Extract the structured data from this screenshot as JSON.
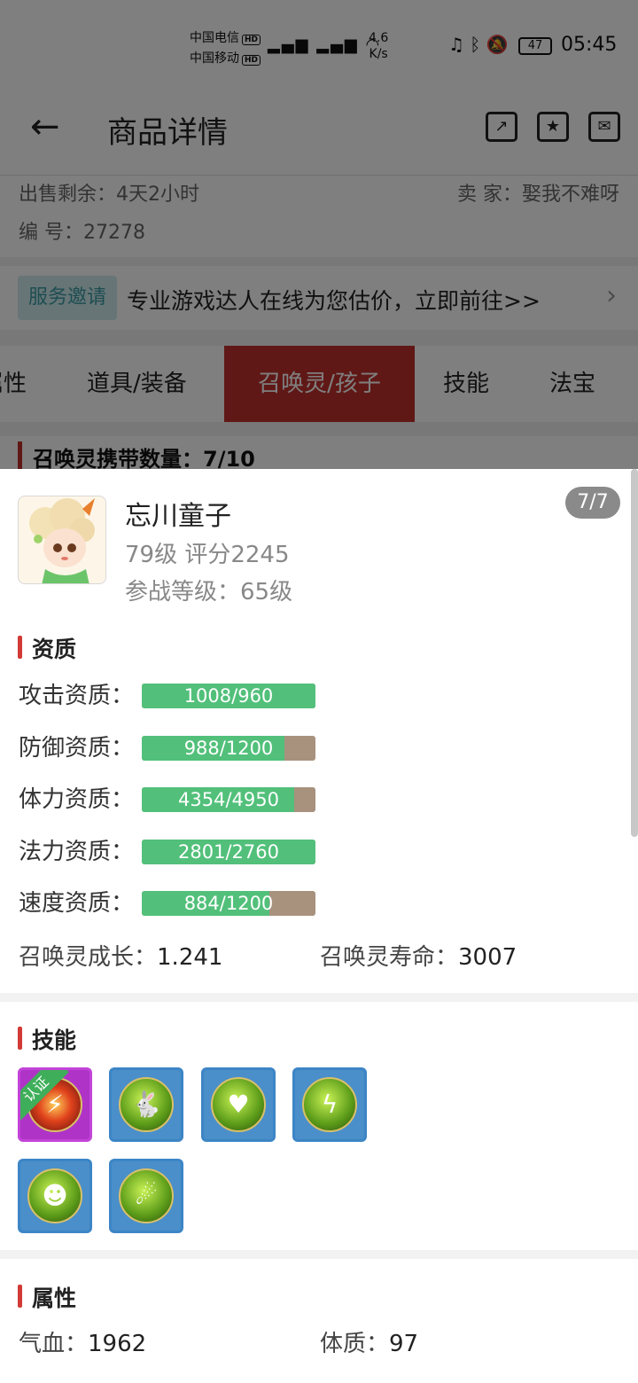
{
  "status_bar": {
    "carrier1": "中国电信",
    "carrier2": "中国移动",
    "hd": "HD",
    "net_speed_value": "4.6",
    "net_speed_unit": "K/s",
    "battery": "47",
    "time": "05:45"
  },
  "nav": {
    "back_icon": "arrow-left-icon",
    "title": "商品详情",
    "icons": [
      "share-icon",
      "favorite-folder-icon",
      "message-icon"
    ]
  },
  "listing": {
    "remaining": "出售剩余：4天2小时",
    "seller": "卖  家：娶我不难呀",
    "number": "编  号：27278"
  },
  "service": {
    "badge": "服务邀请",
    "text": "专业游戏达人在线为您估价，立即前往>>",
    "arrow": "›"
  },
  "tabs": [
    {
      "label": "属性",
      "active": false
    },
    {
      "label": "道具/装备",
      "active": false
    },
    {
      "label": "召唤灵/孩子",
      "active": true
    },
    {
      "label": "技能",
      "active": false
    },
    {
      "label": "法宝",
      "active": false
    }
  ],
  "summon_count": "召唤灵携带数量：7/10",
  "pet": {
    "name": "忘川童子",
    "level_score": "79级 评分2245",
    "battle_level": "参战等级：65级",
    "index": "7/7"
  },
  "aptitude": {
    "title": "资质",
    "rows": [
      {
        "label": "攻击资质：",
        "text": "1008/960",
        "ratio": 1.0
      },
      {
        "label": "防御资质：",
        "text": "988/1200",
        "ratio": 0.823
      },
      {
        "label": "体力资质：",
        "text": "4354/4950",
        "ratio": 0.88
      },
      {
        "label": "法力资质：",
        "text": "2801/2760",
        "ratio": 1.0
      },
      {
        "label": "速度资质：",
        "text": "884/1200",
        "ratio": 0.737
      }
    ],
    "growth_label": "召唤灵成长：",
    "growth_value": "1.241",
    "life_label": "召唤灵寿命：",
    "life_value": "3007",
    "colors": {
      "fill": "#52c07a",
      "empty": "#a8927e"
    }
  },
  "skills": {
    "title": "技能",
    "certified_label": "认证",
    "items": [
      {
        "icon": "fire-strike-skill-icon",
        "certified": true
      },
      {
        "icon": "rabbit-skill-icon",
        "certified": false
      },
      {
        "icon": "green-heart-skill-icon",
        "certified": false
      },
      {
        "icon": "lightning-skill-icon",
        "certified": false
      },
      {
        "icon": "cat-spirit-skill-icon",
        "certified": false
      },
      {
        "icon": "meteor-skill-icon",
        "certified": false
      }
    ]
  },
  "attributes": {
    "title": "属性",
    "hp_label": "气血：",
    "hp_value": "1962",
    "con_label": "体质：",
    "con_value": "97"
  }
}
